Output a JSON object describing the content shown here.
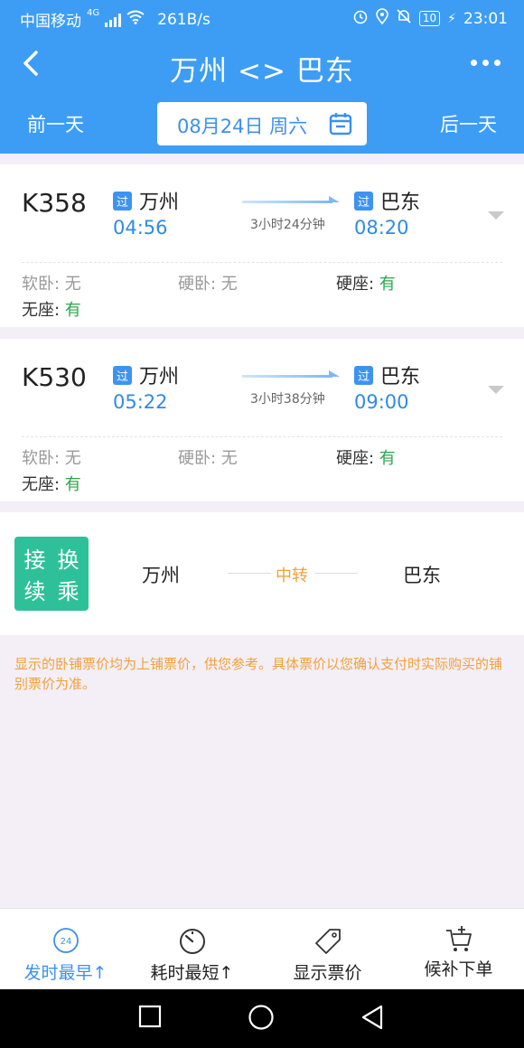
{
  "status_bar": {
    "carrier": "中国移动",
    "network": "4G",
    "speed": "261B/s",
    "battery": "10",
    "time": "23:01"
  },
  "header": {
    "title": "万州 <> 巴东",
    "prev_day": "前一天",
    "next_day": "后一天",
    "date": "08月24日 周六"
  },
  "trains": [
    {
      "number": "K358",
      "from_tag": "过",
      "from": "万州",
      "depart": "04:56",
      "duration": "3小时24分钟",
      "to_tag": "过",
      "to": "巴东",
      "arrive": "08:20",
      "seats": {
        "soft_sleeper": {
          "label": "软卧",
          "value": "无"
        },
        "hard_sleeper": {
          "label": "硬卧",
          "value": "无"
        },
        "hard_seat": {
          "label": "硬座",
          "value": "有"
        },
        "no_seat": {
          "label": "无座",
          "value": "有"
        }
      }
    },
    {
      "number": "K530",
      "from_tag": "过",
      "from": "万州",
      "depart": "05:22",
      "duration": "3小时38分钟",
      "to_tag": "过",
      "to": "巴东",
      "arrive": "09:00",
      "seats": {
        "soft_sleeper": {
          "label": "软卧",
          "value": "无"
        },
        "hard_sleeper": {
          "label": "硬卧",
          "value": "无"
        },
        "hard_seat": {
          "label": "硬座",
          "value": "有"
        },
        "no_seat": {
          "label": "无座",
          "value": "有"
        }
      }
    }
  ],
  "transfer": {
    "badge": [
      "接",
      "换",
      "续",
      "乘"
    ],
    "from": "万州",
    "middle": "中转",
    "to": "巴东"
  },
  "notice": "显示的卧铺票价均为上铺票价，供您参考。具体票价以您确认支付时实际购买的铺别票价为准。",
  "toolbar": {
    "depart_earliest_icon_text": "24",
    "depart_earliest": "发时最早↑",
    "shortest_duration": "耗时最短↑",
    "show_price": "显示票价",
    "waitlist": "候补下单"
  },
  "colors": {
    "header_bg": "#3d9df5",
    "accent": "#3d8ff0",
    "available": "#2aa64b",
    "transfer_badge": "#2ec199",
    "notice": "#f0a13c"
  }
}
